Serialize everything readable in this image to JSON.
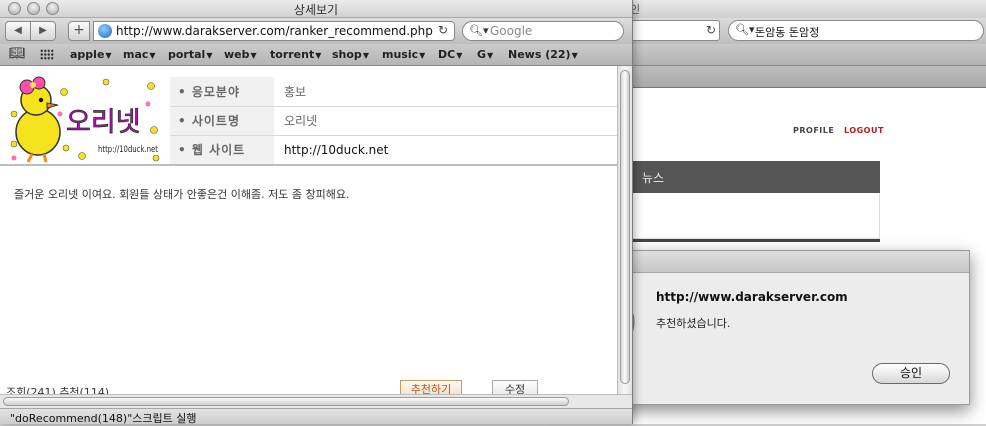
{
  "background_window": {
    "title_fragment": "인",
    "search_value": "돈암동 돈암정",
    "profile_label": "PROFILE",
    "logout_label": "LOGOUT",
    "news_label": "뉴스"
  },
  "alert": {
    "title": "http://www.darakserver.com",
    "message": "추천하셨습니다.",
    "ok_label": "승인"
  },
  "popup": {
    "title": "상세보기",
    "url": "http://www.darakserver.com/ranker_recommend.php",
    "search_placeholder": "Google",
    "bookmarks": [
      {
        "label": "apple"
      },
      {
        "label": "mac"
      },
      {
        "label": "portal"
      },
      {
        "label": "web"
      },
      {
        "label": "torrent"
      },
      {
        "label": "shop"
      },
      {
        "label": "music"
      },
      {
        "label": "DC"
      },
      {
        "label": "G"
      },
      {
        "label": "News (22)"
      }
    ],
    "logo": {
      "text": "오리넷",
      "url_text": "http://10duck.net"
    },
    "fields": [
      {
        "label": "• 응모분야",
        "value": "홍보"
      },
      {
        "label": "• 사이트명",
        "value": "오리넷"
      },
      {
        "label": "• 웹 사이트",
        "value": "http://10duck.net"
      }
    ],
    "comment": "즐거운 오리넷 이여요. 회원들 상태가 안좋은건 이해좀. 저도 좀 창피해요.",
    "stats": "조회(241) 추천(114)",
    "recommend_label": "추천하기",
    "edit_label": "수정",
    "status_text": "\"doRecommend(148)\"스크립트 실행"
  },
  "colors": {
    "logout": "#b21e1e",
    "recommend_text": "#b4562b",
    "news_bar": "#555555"
  }
}
